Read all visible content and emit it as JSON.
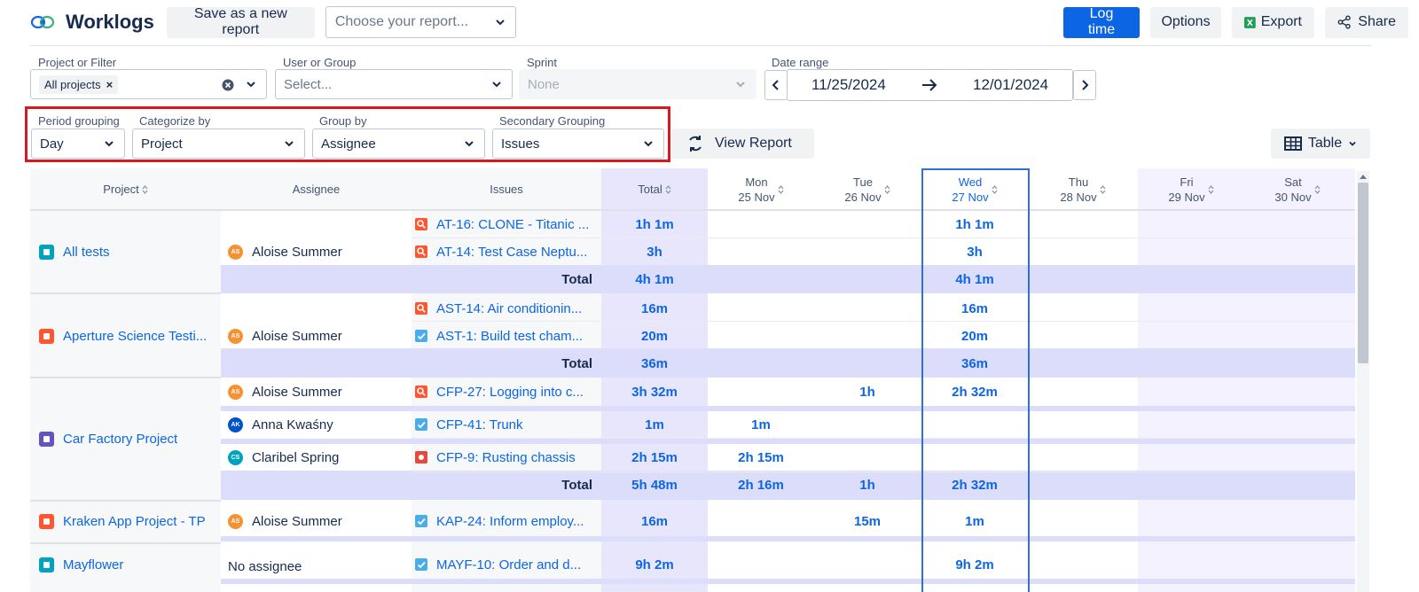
{
  "header": {
    "title": "Worklogs",
    "save_report": "Save as a new report",
    "choose_report_placeholder": "Choose your report...",
    "log_time": "Log time",
    "options": "Options",
    "export": "Export",
    "share": "Share"
  },
  "filters": {
    "project_label": "Project or Filter",
    "project_chip": "All projects",
    "user_label": "User or Group",
    "user_placeholder": "Select...",
    "sprint_label": "Sprint",
    "sprint_value": "None",
    "date_label": "Date range",
    "date_from": "11/25/2024",
    "date_to": "12/01/2024"
  },
  "grouping": {
    "period_label": "Period grouping",
    "period_value": "Day",
    "categorize_label": "Categorize by",
    "categorize_value": "Project",
    "group_label": "Group by",
    "group_value": "Assignee",
    "secondary_label": "Secondary Grouping",
    "secondary_value": "Issues",
    "view_report": "View Report",
    "view_mode": "Table"
  },
  "table": {
    "headers": {
      "project": "Project",
      "assignee": "Assignee",
      "issues": "Issues",
      "total": "Total",
      "days": [
        {
          "dow": "Mon",
          "date": "25 Nov"
        },
        {
          "dow": "Tue",
          "date": "26 Nov"
        },
        {
          "dow": "Wed",
          "date": "27 Nov"
        },
        {
          "dow": "Thu",
          "date": "28 Nov"
        },
        {
          "dow": "Fri",
          "date": "29 Nov"
        },
        {
          "dow": "Sat",
          "date": "30 Nov"
        }
      ]
    },
    "total_label": "Total",
    "projects": [
      {
        "name": "All tests",
        "icon": "test-project-icon",
        "color": "#00a3bf"
      },
      {
        "name": "Aperture Science Testi...",
        "icon": "science-project-icon",
        "color": "#ff5630"
      },
      {
        "name": "Car Factory Project",
        "icon": "factory-project-icon",
        "color": "#6554c0"
      },
      {
        "name": "Kraken App Project - TP",
        "icon": "kraken-project-icon",
        "color": "#ff5630"
      },
      {
        "name": "Mayflower",
        "icon": "ship-project-icon",
        "color": "#00a3bf"
      }
    ],
    "assignees": [
      {
        "name": "Aloise Summer",
        "initials": "AS",
        "color": "#f79233"
      },
      {
        "name": "Aloise Summer",
        "initials": "AS",
        "color": "#f79233"
      },
      {
        "name": "Aloise Summer",
        "initials": "AS",
        "color": "#f79233"
      },
      {
        "name": "Anna Kwaśny",
        "initials": "AK",
        "color": "#0052cc"
      },
      {
        "name": "Claribel Spring",
        "initials": "CS",
        "color": "#00a3bf"
      },
      {
        "name": "Aloise Summer",
        "initials": "AS",
        "color": "#f79233"
      },
      {
        "name": "No assignee",
        "initials": "",
        "color": ""
      }
    ],
    "rows": [
      {
        "issue": "AT-16: CLONE - Titanic ...",
        "type": "test",
        "total": "1h 1m",
        "days": [
          "",
          "",
          "1h 1m",
          "",
          "",
          ""
        ]
      },
      {
        "issue": "AT-14: Test Case Neptu...",
        "type": "test",
        "total": "3h",
        "days": [
          "",
          "",
          "3h",
          "",
          "",
          ""
        ]
      },
      {
        "issue": "",
        "type": "total",
        "total": "4h 1m",
        "days": [
          "",
          "",
          "4h 1m",
          "",
          "",
          ""
        ]
      },
      {
        "issue": "AST-14: Air conditionin...",
        "type": "test",
        "total": "16m",
        "days": [
          "",
          "",
          "16m",
          "",
          "",
          ""
        ]
      },
      {
        "issue": "AST-1: Build test cham...",
        "type": "task",
        "total": "20m",
        "days": [
          "",
          "",
          "20m",
          "",
          "",
          ""
        ]
      },
      {
        "issue": "",
        "type": "total",
        "total": "36m",
        "days": [
          "",
          "",
          "36m",
          "",
          "",
          ""
        ]
      },
      {
        "issue": "CFP-27: Logging into c...",
        "type": "test",
        "total": "3h 32m",
        "days": [
          "",
          "1h",
          "2h 32m",
          "",
          "",
          ""
        ]
      },
      {
        "issue": "CFP-41: Trunk",
        "type": "task",
        "total": "1m",
        "days": [
          "1m",
          "",
          "",
          "",
          "",
          ""
        ]
      },
      {
        "issue": "CFP-9: Rusting chassis",
        "type": "bug",
        "total": "2h 15m",
        "days": [
          "2h 15m",
          "",
          "",
          "",
          "",
          ""
        ]
      },
      {
        "issue": "",
        "type": "total",
        "total": "5h 48m",
        "days": [
          "2h 16m",
          "1h",
          "2h 32m",
          "",
          "",
          ""
        ]
      },
      {
        "issue": "KAP-24: Inform employ...",
        "type": "task",
        "total": "16m",
        "days": [
          "",
          "15m",
          "1m",
          "",
          "",
          ""
        ]
      },
      {
        "issue": "MAYF-10: Order and d...",
        "type": "task",
        "total": "9h 2m",
        "days": [
          "",
          "",
          "9h 2m",
          "",
          "",
          ""
        ]
      }
    ]
  },
  "colors": {
    "primary": "#0c66e4",
    "total_band": "#dcdcfb",
    "highlight_col": "#e8e6fd",
    "highlight_border": "#2f6fdc",
    "red_box": "#d8191f"
  }
}
